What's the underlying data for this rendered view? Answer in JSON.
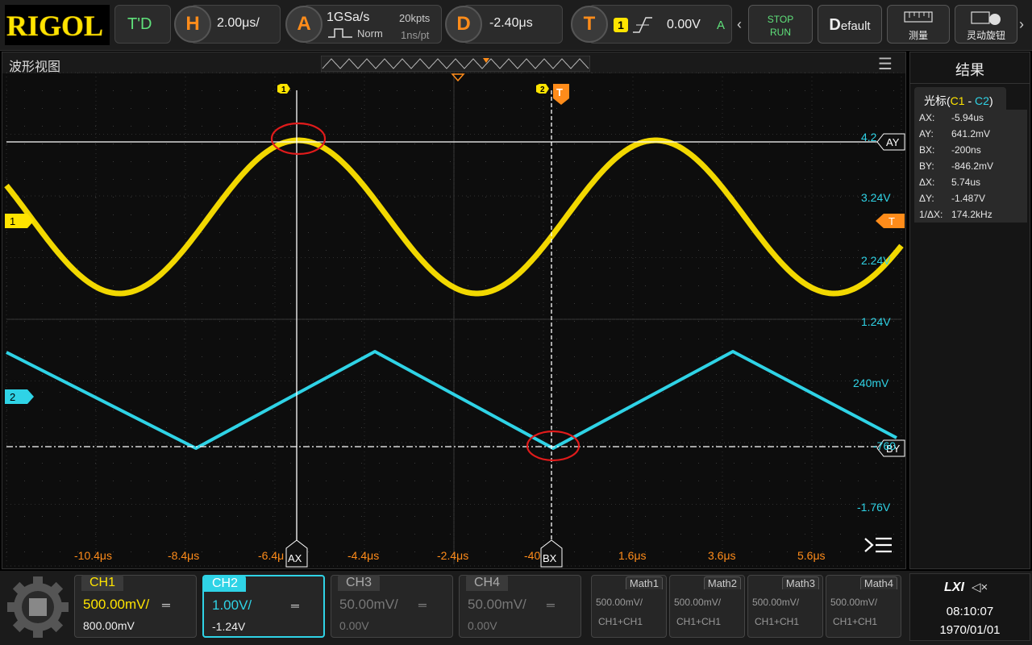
{
  "header": {
    "logo": "RIGOL",
    "mode": "T'D",
    "horizontal": {
      "key": "H",
      "value": "2.00μs/"
    },
    "acquire": {
      "key": "A",
      "rate": "1GSa/s",
      "depth": "20kpts",
      "mode": "Norm",
      "resolution": "1ns/pt"
    },
    "delay": {
      "key": "D",
      "value": "-2.40μs"
    },
    "trigger": {
      "key": "T",
      "source": "1",
      "level": "0.00V",
      "sweep": "A"
    },
    "buttons": {
      "stop": "STOP",
      "run": "RUN",
      "default_d": "D",
      "default_rest": "efault",
      "measure": "测量",
      "knob": "灵动旋钮"
    }
  },
  "waveform": {
    "title": "波形视图",
    "cursor_a_marker": "1",
    "cursor_b_marker": "2",
    "trigger_marker": "T",
    "ch1_marker": "1",
    "ch2_marker": "2",
    "ay_label": "AY",
    "by_label": "BY",
    "ax_label": "AX",
    "bx_label": "BX",
    "y_ticks": [
      "4.2",
      "3.24V",
      "2.24V",
      "1.24V",
      "240mV",
      "-760",
      "-1.76V"
    ],
    "x_ticks": [
      "-10.4μs",
      "-8.4μs",
      "-6.4μ",
      "-4.4μs",
      "-2.4μs",
      "-40",
      "1.6μs",
      "3.6μs",
      "5.6μs"
    ]
  },
  "results": {
    "title": "结果",
    "cursor_title_prefix": "光标(",
    "cursor_c1": "C1",
    "cursor_dash": " - ",
    "cursor_c2": "C2",
    "cursor_title_suffix": ")",
    "rows": [
      {
        "k": "AX:",
        "v": "-5.94us"
      },
      {
        "k": "AY:",
        "v": "641.2mV"
      },
      {
        "k": "BX:",
        "v": "-200ns"
      },
      {
        "k": "BY:",
        "v": "-846.2mV"
      },
      {
        "k": "ΔX:",
        "v": "5.74us"
      },
      {
        "k": "ΔY:",
        "v": "-1.487V"
      },
      {
        "k": "1/ΔX:",
        "v": "174.2kHz"
      }
    ]
  },
  "channels": [
    {
      "name": "CH1",
      "scale": "500.00mV/",
      "offset": "800.00mV",
      "color": "#ffe400",
      "active": true
    },
    {
      "name": "CH2",
      "scale": "1.00V/",
      "offset": "-1.24V",
      "color": "#2fd3e6",
      "active": true
    },
    {
      "name": "CH3",
      "scale": "50.00mV/",
      "offset": "0.00V",
      "color": "#777777",
      "active": false
    },
    {
      "name": "CH4",
      "scale": "50.00mV/",
      "offset": "0.00V",
      "color": "#777777",
      "active": false
    }
  ],
  "maths": [
    {
      "name": "Math1",
      "scale": "500.00mV/",
      "expr": "CH1+CH1"
    },
    {
      "name": "Math2",
      "scale": "500.00mV/",
      "expr": "CH1+CH1"
    },
    {
      "name": "Math3",
      "scale": "500.00mV/",
      "expr": "CH1+CH1"
    },
    {
      "name": "Math4",
      "scale": "500.00mV/",
      "expr": "CH1+CH1"
    }
  ],
  "status": {
    "lxi": "LXI",
    "time": "08:10:07",
    "date": "1970/01/01"
  },
  "colors": {
    "ch1": "#ffe400",
    "ch2": "#2fd3e6",
    "accent": "#ff8c1a",
    "cursor": "#ffffff",
    "highlight": "#e01b1b"
  }
}
